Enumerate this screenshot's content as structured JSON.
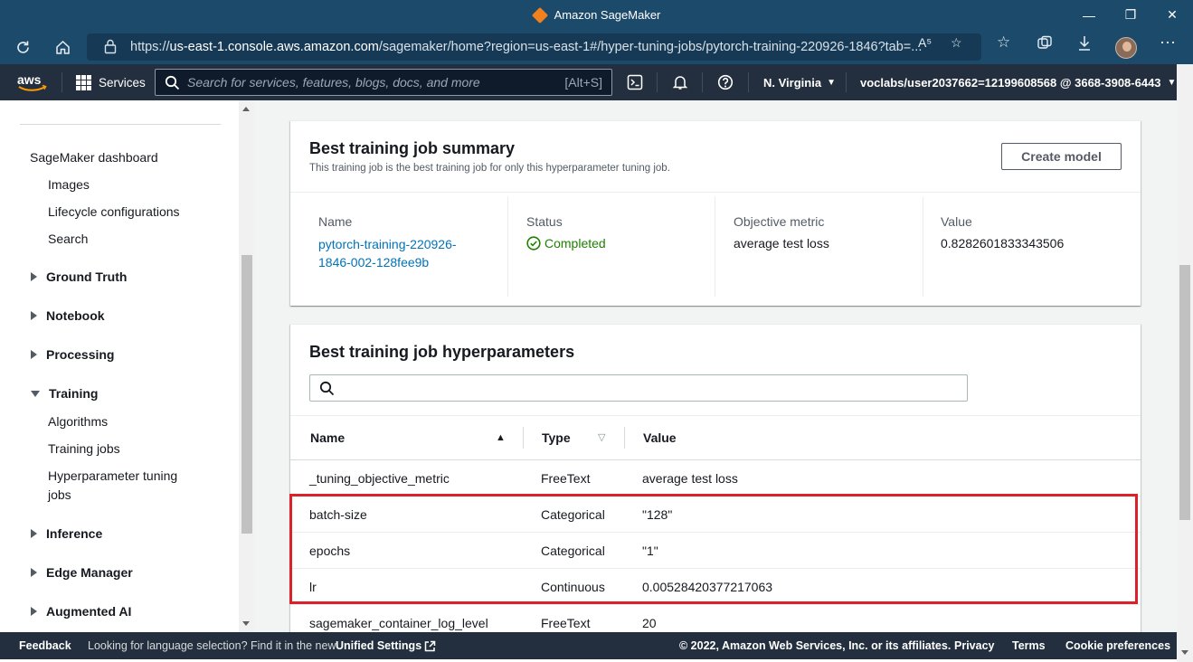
{
  "browser": {
    "title": "Amazon SageMaker",
    "url_prefix": "https://",
    "url_host": "us-east-1.console.aws.amazon.com",
    "url_path": "/sagemaker/home?region=us-east-1#/hyper-tuning-jobs/pytorch-training-220926-1846?tab=..."
  },
  "aws_nav": {
    "services_label": "Services",
    "search_placeholder": "Search for services, features, blogs, docs, and more",
    "search_shortcut": "[Alt+S]",
    "region": "N. Virginia",
    "account": "voclabs/user2037662=12199608568 @ 3668-3908-6443"
  },
  "sidebar": {
    "dashboard": "SageMaker dashboard",
    "dashboard_items": [
      "Images",
      "Lifecycle configurations",
      "Search"
    ],
    "sections": {
      "ground_truth": "Ground Truth",
      "notebook": "Notebook",
      "processing": "Processing",
      "training": "Training",
      "inference": "Inference",
      "edge_manager": "Edge Manager",
      "augmented_ai": "Augmented AI"
    },
    "training_items": {
      "algorithms": "Algorithms",
      "training_jobs": "Training jobs",
      "hpt_line1": "Hyperparameter tuning",
      "hpt_line2": "jobs"
    }
  },
  "summary": {
    "title": "Best training job summary",
    "description": "This training job is the best training job for only this hyperparameter tuning job.",
    "create_model_label": "Create model",
    "name_label": "Name",
    "name_line1": "pytorch-training-220926-",
    "name_line2": "1846-002-128fee9b",
    "status_label": "Status",
    "status_value": "Completed",
    "objective_label": "Objective metric",
    "objective_value": "average test loss",
    "value_label": "Value",
    "value_value": "0.8282601833343506"
  },
  "hyperparameters": {
    "title": "Best training job hyperparameters",
    "columns": {
      "name": "Name",
      "type": "Type",
      "value": "Value"
    },
    "rows": [
      {
        "name": "_tuning_objective_metric",
        "type": "FreeText",
        "value": "average test loss"
      },
      {
        "name": "batch-size",
        "type": "Categorical",
        "value": "\"128\""
      },
      {
        "name": "epochs",
        "type": "Categorical",
        "value": "\"1\""
      },
      {
        "name": "lr",
        "type": "Continuous",
        "value": "0.00528420377217063"
      },
      {
        "name": "sagemaker_container_log_level",
        "type": "FreeText",
        "value": "20"
      }
    ]
  },
  "footer": {
    "feedback": "Feedback",
    "language_text": "Looking for language selection? Find it in the new",
    "unified_settings": "Unified Settings",
    "copyright": "© 2022, Amazon Web Services, Inc. or its affiliates.",
    "privacy": "Privacy",
    "terms": "Terms",
    "cookie": "Cookie preferences"
  },
  "colors": {
    "browser_chrome": "#1c4a6b",
    "aws_nav": "#232f3e",
    "link": "#0073bb",
    "success": "#1d8102",
    "highlight_box": "#d9222a"
  }
}
